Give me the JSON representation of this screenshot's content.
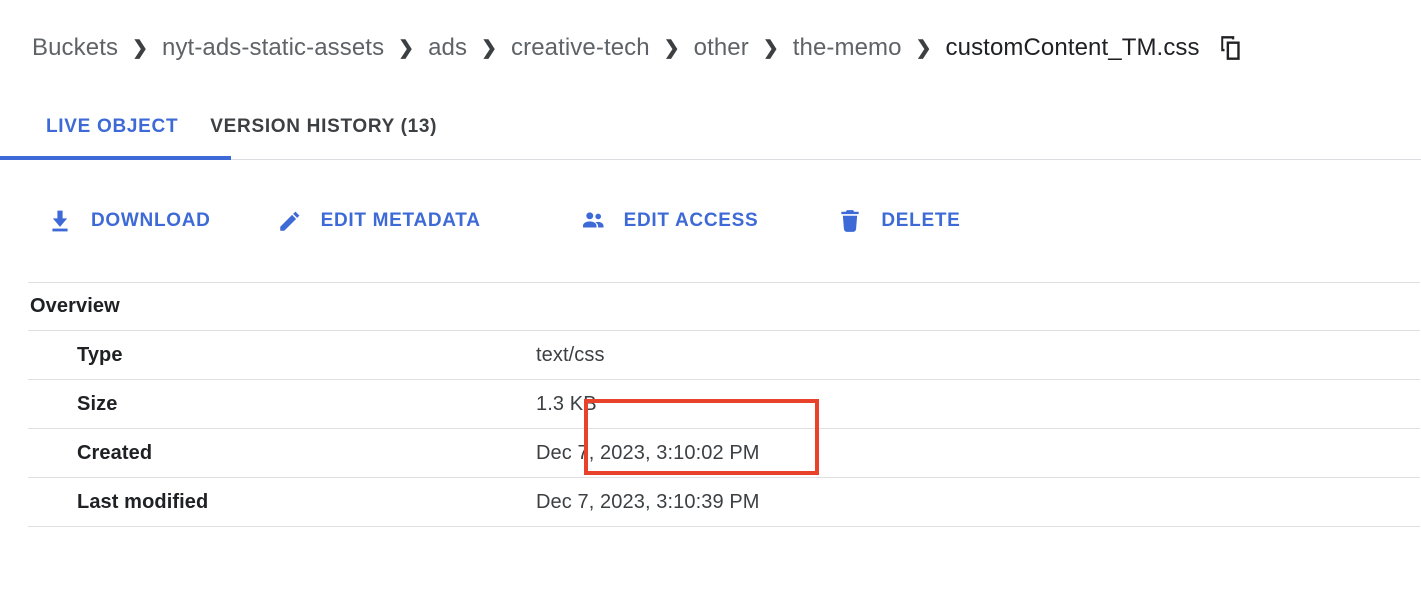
{
  "breadcrumb": {
    "separator": "❯",
    "items": [
      {
        "label": "Buckets",
        "current": false
      },
      {
        "label": "nyt-ads-static-assets",
        "current": false
      },
      {
        "label": "ads",
        "current": false
      },
      {
        "label": "creative-tech",
        "current": false
      },
      {
        "label": "other",
        "current": false
      },
      {
        "label": "the-memo",
        "current": false
      },
      {
        "label": "customContent_TM.css",
        "current": true
      }
    ],
    "copy_icon": "copy-icon"
  },
  "tabs": [
    {
      "label": "LIVE OBJECT",
      "active": true
    },
    {
      "label": "VERSION HISTORY (13)",
      "active": false
    }
  ],
  "toolbar": {
    "download_label": "DOWNLOAD",
    "download_icon": "download-icon",
    "edit_metadata_label": "EDIT METADATA",
    "edit_metadata_icon": "pencil-icon",
    "edit_access_label": "EDIT ACCESS",
    "edit_access_icon": "people-icon",
    "delete_label": "DELETE",
    "delete_icon": "trash-icon"
  },
  "overview": {
    "title": "Overview",
    "rows": [
      {
        "key": "Type",
        "value": "text/css"
      },
      {
        "key": "Size",
        "value": "1.3 KB"
      },
      {
        "key": "Created",
        "value": "Dec 7, 2023, 3:10:02 PM"
      },
      {
        "key": "Last modified",
        "value": "Dec 7, 2023, 3:10:39 PM"
      }
    ]
  },
  "colors": {
    "accent_blue": "#3d6ad6",
    "highlight_red": "#e8432a",
    "text_primary": "#202124",
    "text_secondary": "#5f6368",
    "divider": "#e0e0e0"
  }
}
